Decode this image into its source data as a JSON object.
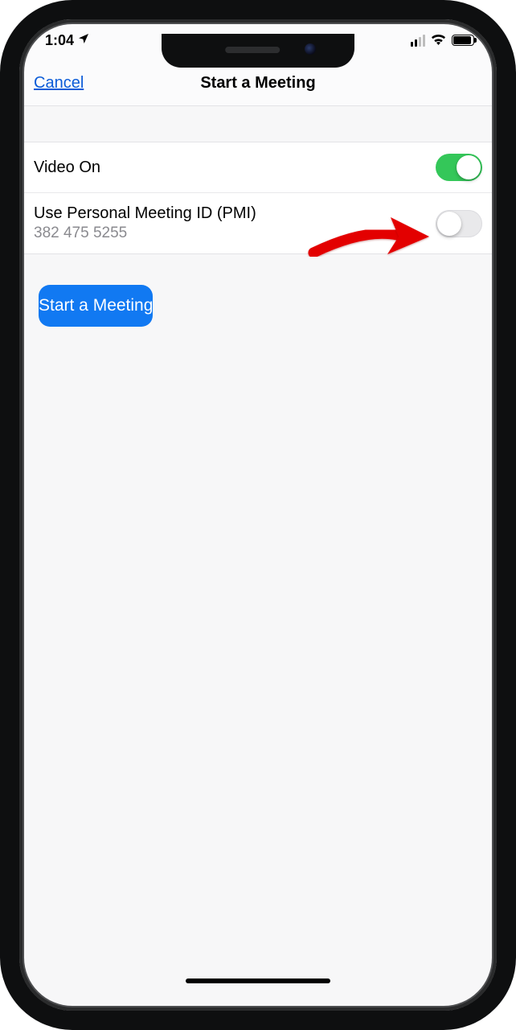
{
  "status": {
    "time": "1:04"
  },
  "nav": {
    "cancel": "Cancel",
    "title": "Start a Meeting"
  },
  "rows": {
    "video": {
      "label": "Video On",
      "on": true
    },
    "pmi": {
      "label": "Use Personal Meeting ID (PMI)",
      "value": "382 475 5255",
      "on": false
    }
  },
  "primary_button": "Start a Meeting",
  "annotation": {
    "arrow": true
  }
}
